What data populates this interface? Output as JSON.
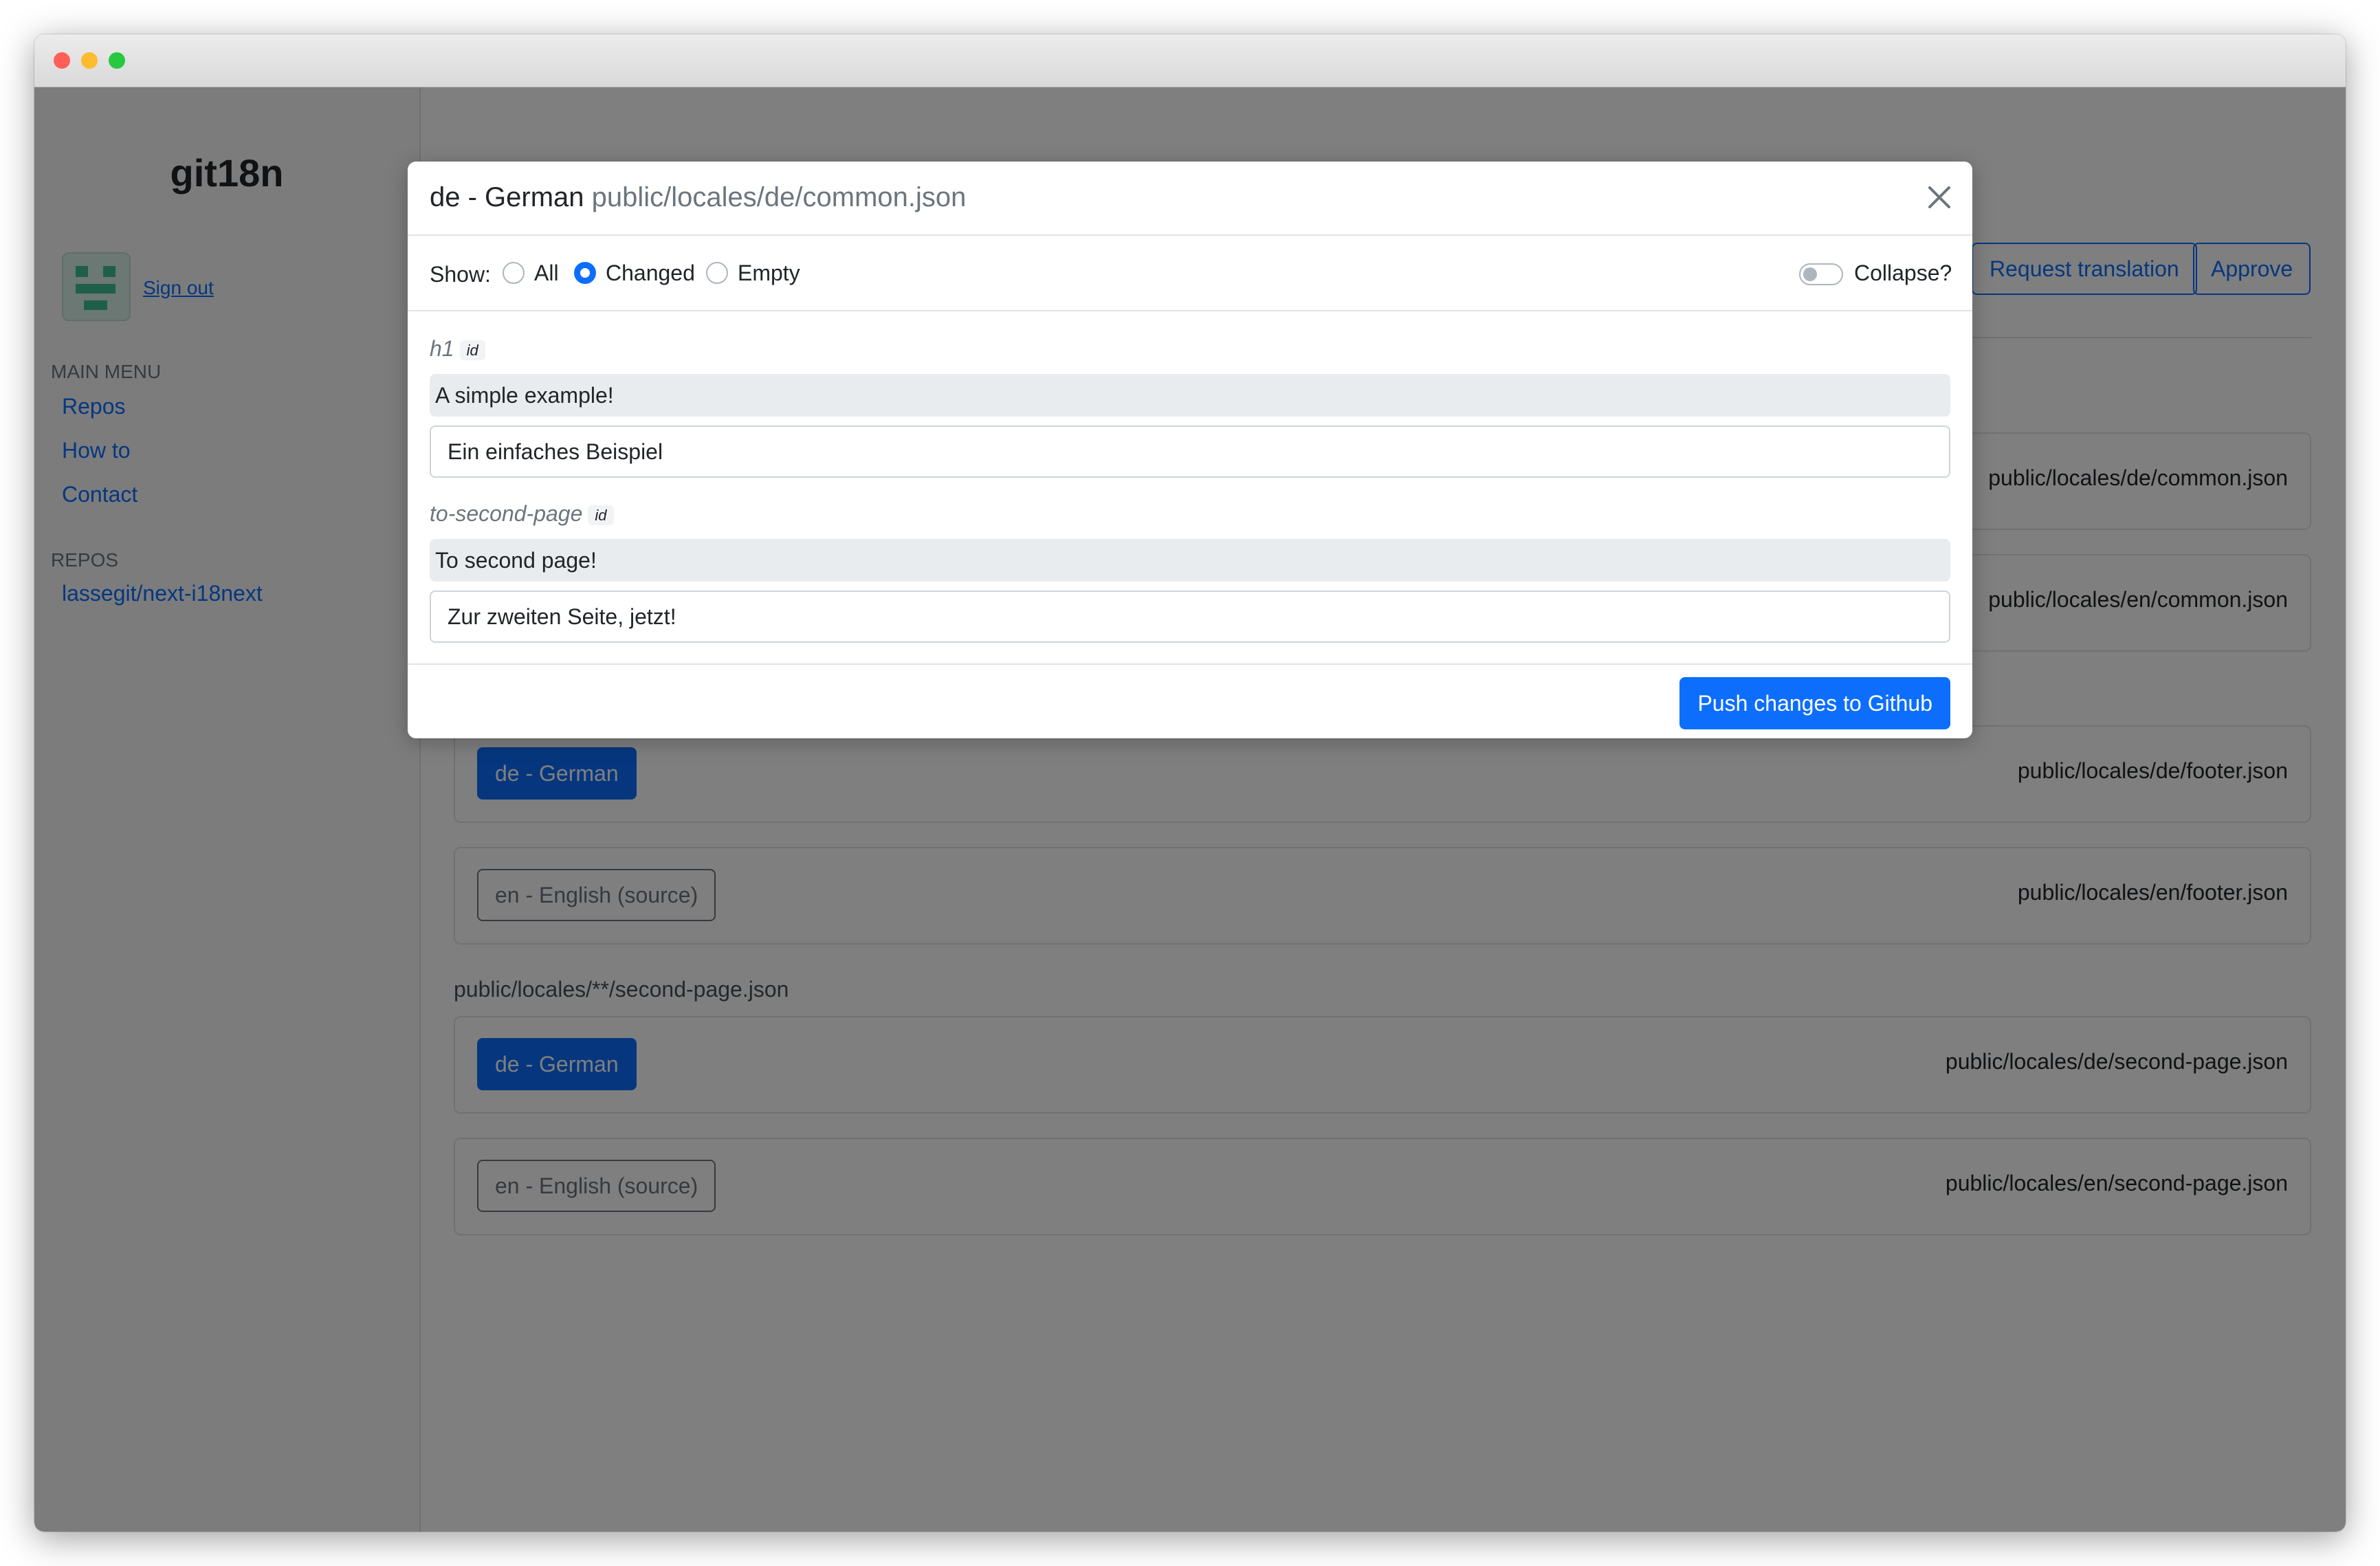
{
  "sidebar": {
    "brand": "git18n",
    "sign_out": "Sign out",
    "main_menu_label": "MAIN MENU",
    "menu_items": [
      "Repos",
      "How to",
      "Contact"
    ],
    "repos_label": "REPOS",
    "repos": [
      "lassegit/next-i18next"
    ]
  },
  "header": {
    "request_translation": "Request translation",
    "approve": "Approve"
  },
  "files": {
    "common_cards": [
      {
        "path": "public/locales/de/common.json"
      },
      {
        "path": "public/locales/en/common.json"
      }
    ],
    "footer_cards": [
      {
        "lang": "de - German",
        "path": "public/locales/de/footer.json"
      },
      {
        "lang": "en - English (source)",
        "path": "public/locales/en/footer.json"
      }
    ],
    "second_page_group": "public/locales/**/second-page.json",
    "second_page_cards": [
      {
        "lang": "de - German",
        "path": "public/locales/de/second-page.json"
      },
      {
        "lang": "en - English (source)",
        "path": "public/locales/en/second-page.json"
      }
    ]
  },
  "modal": {
    "title": "de - German",
    "title_path": "public/locales/de/common.json",
    "show_label": "Show:",
    "filter_options": [
      "All",
      "Changed",
      "Empty"
    ],
    "filter_selected": "Changed",
    "collapse_label": "Collapse?",
    "collapse_on": false,
    "id_badge": "id",
    "entries": [
      {
        "key": "h1",
        "source": "A simple example!",
        "translation": "Ein einfaches Beispiel"
      },
      {
        "key": "to-second-page",
        "source": "To second page!",
        "translation": "Zur zweiten Seite, jetzt!"
      }
    ],
    "push_button": "Push changes to Github"
  },
  "colors": {
    "primary": "#0d6efd",
    "secondary": "#6c757d",
    "backdrop": "rgba(0,0,0,0.5)"
  }
}
